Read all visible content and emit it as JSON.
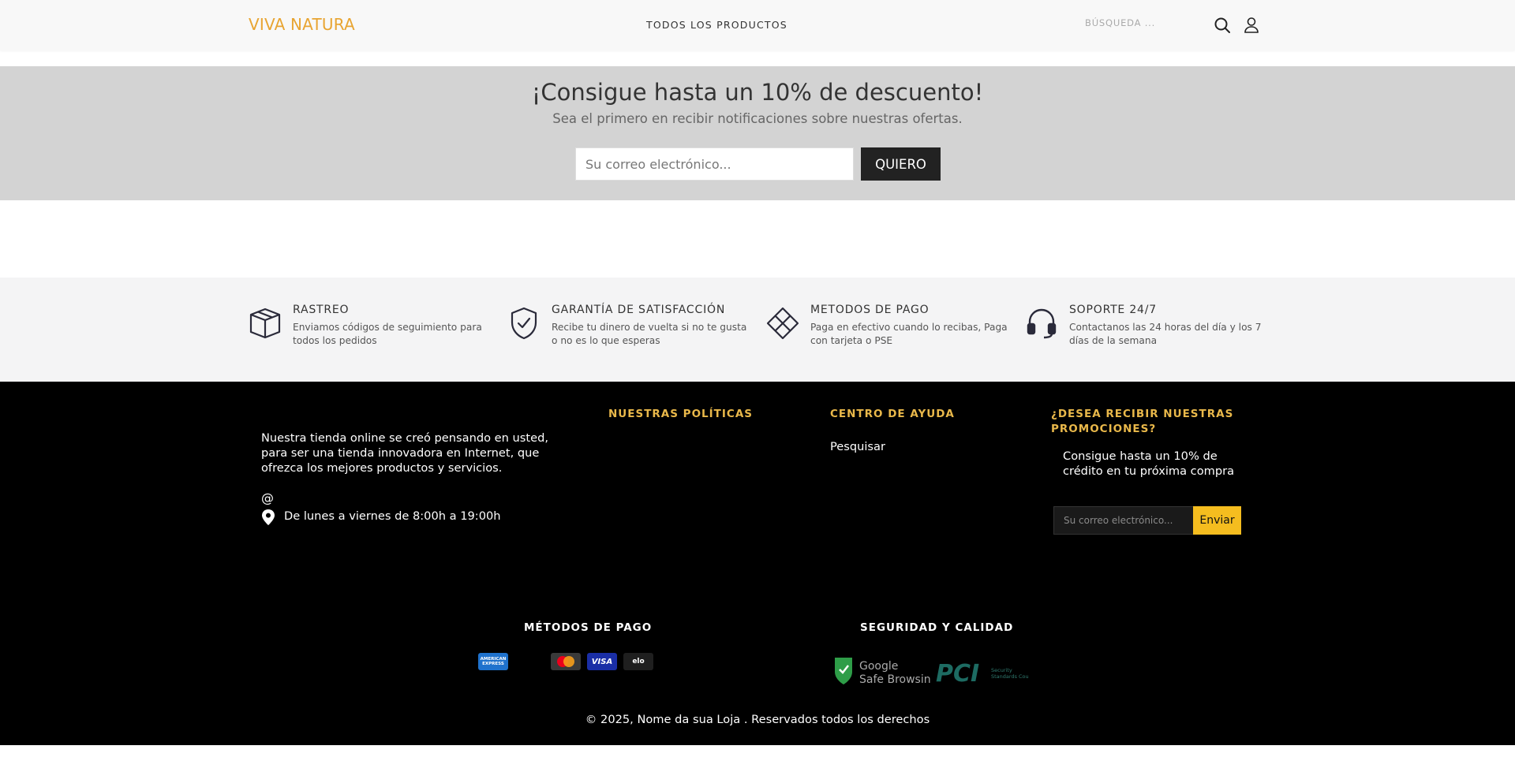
{
  "header": {
    "logo": "VIVA NATURA",
    "nav_all_products": "TODOS LOS PRODUCTOS",
    "search_placeholder": "BÚSQUEDA ...",
    "search_icon": "search-icon",
    "user_icon": "user-icon"
  },
  "promo": {
    "title": "¡Consigue hasta un 10% de descuento!",
    "subtitle": "Sea el primero en recibir notificaciones sobre nuestras ofertas.",
    "email_placeholder": "Su correo electrónico...",
    "button_label": "QUIERO"
  },
  "features": [
    {
      "icon": "box-icon",
      "title": "RASTREO",
      "description": "Enviamos códigos de seguimiento para todos los pedidos"
    },
    {
      "icon": "shield-check-icon",
      "title": "GARANTÍA DE SATISFACCIÓN",
      "description": "Recibe tu dinero de vuelta si no te gusta o no es lo que esperas"
    },
    {
      "icon": "payment-diamond-icon",
      "title": "METODOS DE PAGO",
      "description": "Paga en efectivo cuando lo recibas, Paga con tarjeta o PSE"
    },
    {
      "icon": "headset-icon",
      "title": "SOPORTE 24/7",
      "description": "Contactanos las 24 horas del día y los 7 días de la semana"
    }
  ],
  "footer": {
    "about": "Nuestra tienda online se creó pensando en usted, para ser una tienda innovadora en Internet, que ofrezca los mejores productos y servicios.",
    "email_symbol": "@",
    "hours": "De lunes a viernes de 8:00h a 19:00h",
    "policies_title": "NUESTRAS POLÍTICAS",
    "help_title": "CENTRO DE AYUDA",
    "help_link": "Pesquisar",
    "promo_title": "¿DESEA RECIBIR NUESTRAS PROMOCIONES?",
    "promo_text": "Consigue hasta un 10% de crédito en tu próxima compra",
    "email_placeholder": "Su correo electrónico...",
    "send_button": "Enviar",
    "payment_title": "MÉTODOS DE PAGO",
    "payment_cards": {
      "amex": "AMERICAN EXPRESS",
      "visa": "VISA",
      "elo": "elo"
    },
    "security_title": "SEGURIDAD Y CALIDAD",
    "security_badges": {
      "google_line1": "Google",
      "google_line2": "Safe Browsing",
      "pci_mark": "PCI",
      "pci_line1": "Security",
      "pci_line2": "Standards Council"
    },
    "copyright": "© 2025, Nome da sua Loja . Reservados todos los derechos"
  },
  "colors": {
    "logo": "#e8a431",
    "accent_gold": "#e9b84a",
    "send_button": "#f5bd1f",
    "promo_bg": "#d3d3d3",
    "footer_bg": "#000000"
  }
}
